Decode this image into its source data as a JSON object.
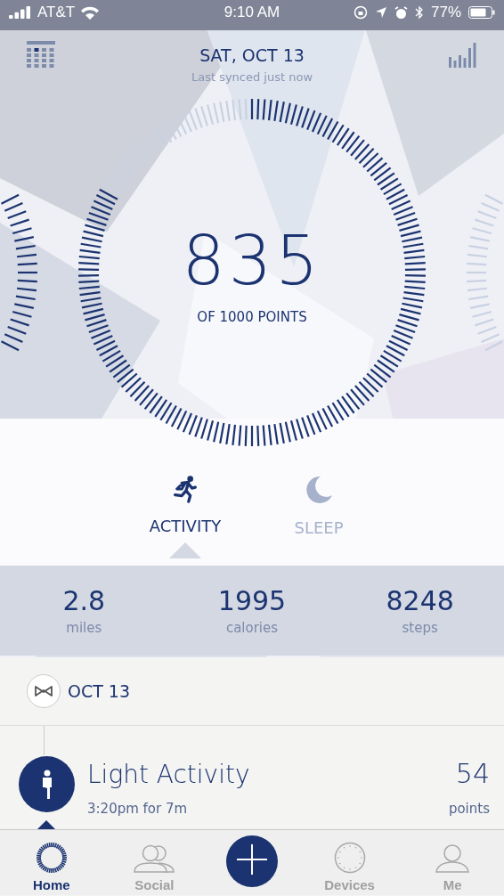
{
  "status_bar": {
    "carrier": "AT&T",
    "time": "9:10 AM",
    "battery": "77%"
  },
  "header": {
    "date": "SAT, OCT 13",
    "sync": "Last synced just now"
  },
  "score": {
    "value": "835",
    "caption": "OF 1000 POINTS"
  },
  "tabs": [
    {
      "kind": "activity",
      "label": "ACTIVITY",
      "selected": true
    },
    {
      "kind": "sleep",
      "label": "SLEEP",
      "selected": false
    }
  ],
  "stats": [
    {
      "value": "2.8",
      "unit": "miles"
    },
    {
      "value": "1995",
      "unit": "calories"
    },
    {
      "value": "8248",
      "unit": "steps"
    }
  ],
  "timeline": {
    "date": "OCT 13",
    "entries": [
      {
        "title": "Light Activity",
        "subtitle": "3:20pm for 7m",
        "points": "54",
        "points_label": "points"
      }
    ]
  },
  "nav": [
    {
      "kind": "home",
      "label": "Home",
      "selected": true
    },
    {
      "kind": "social",
      "label": "Social",
      "selected": false
    },
    {
      "kind": "add",
      "selected": false
    },
    {
      "kind": "devices",
      "label": "Devices",
      "selected": false
    },
    {
      "kind": "me",
      "label": "Me",
      "selected": false
    }
  ]
}
